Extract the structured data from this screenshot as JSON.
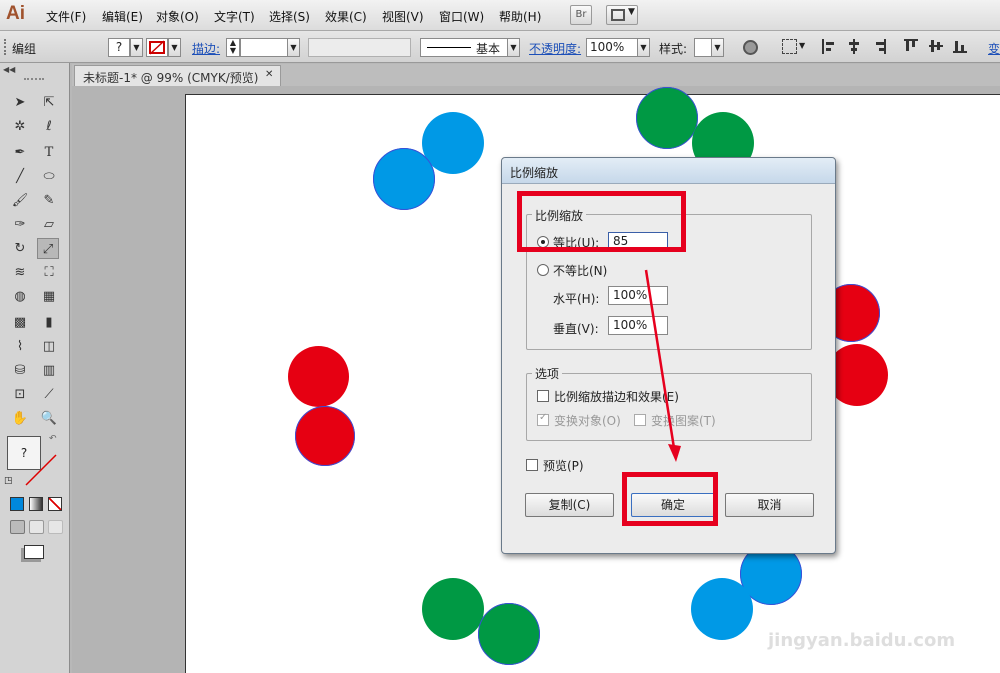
{
  "app": {
    "logo": "Ai"
  },
  "menu": [
    "文件(F)",
    "编辑(E)",
    "对象(O)",
    "文字(T)",
    "选择(S)",
    "效果(C)",
    "视图(V)",
    "窗口(W)",
    "帮助(H)"
  ],
  "toolbar_top": {
    "br_label": "Br",
    "layout_icon": "layout-icon"
  },
  "controlbar": {
    "group_label": "编组",
    "fill_value": "?",
    "stroke_label": "描边:",
    "stroke_style": "基本",
    "opacity_label": "不透明度:",
    "opacity_value": "100%",
    "style_label": "样式:",
    "transform_label": "变"
  },
  "tab": {
    "title": "未标题-1* @ 99% (CMYK/预览)",
    "close": "✕"
  },
  "tools_panel": {
    "fill_indicator": "?"
  },
  "dialog": {
    "title": "比例缩放",
    "scale_group": "比例缩放",
    "uniform_label": "等比(U):",
    "uniform_value": "85",
    "nonuniform_label": "不等比(N)",
    "horizontal_label": "水平(H):",
    "horizontal_value": "100%",
    "vertical_label": "垂直(V):",
    "vertical_value": "100%",
    "options_group": "选项",
    "scale_strokes_label": "比例缩放描边和效果(E)",
    "transform_objects_label": "变换对象(O)",
    "transform_patterns_label": "变换图案(T)",
    "preview_label": "预览(P)",
    "copy_button": "复制(C)",
    "ok_button": "确定",
    "cancel_button": "取消"
  },
  "colors": {
    "blue": "#0099e6",
    "green": "#009944",
    "red": "#e60012",
    "highlight": "#e6001e"
  },
  "watermark": "jingyan.baidu.com"
}
